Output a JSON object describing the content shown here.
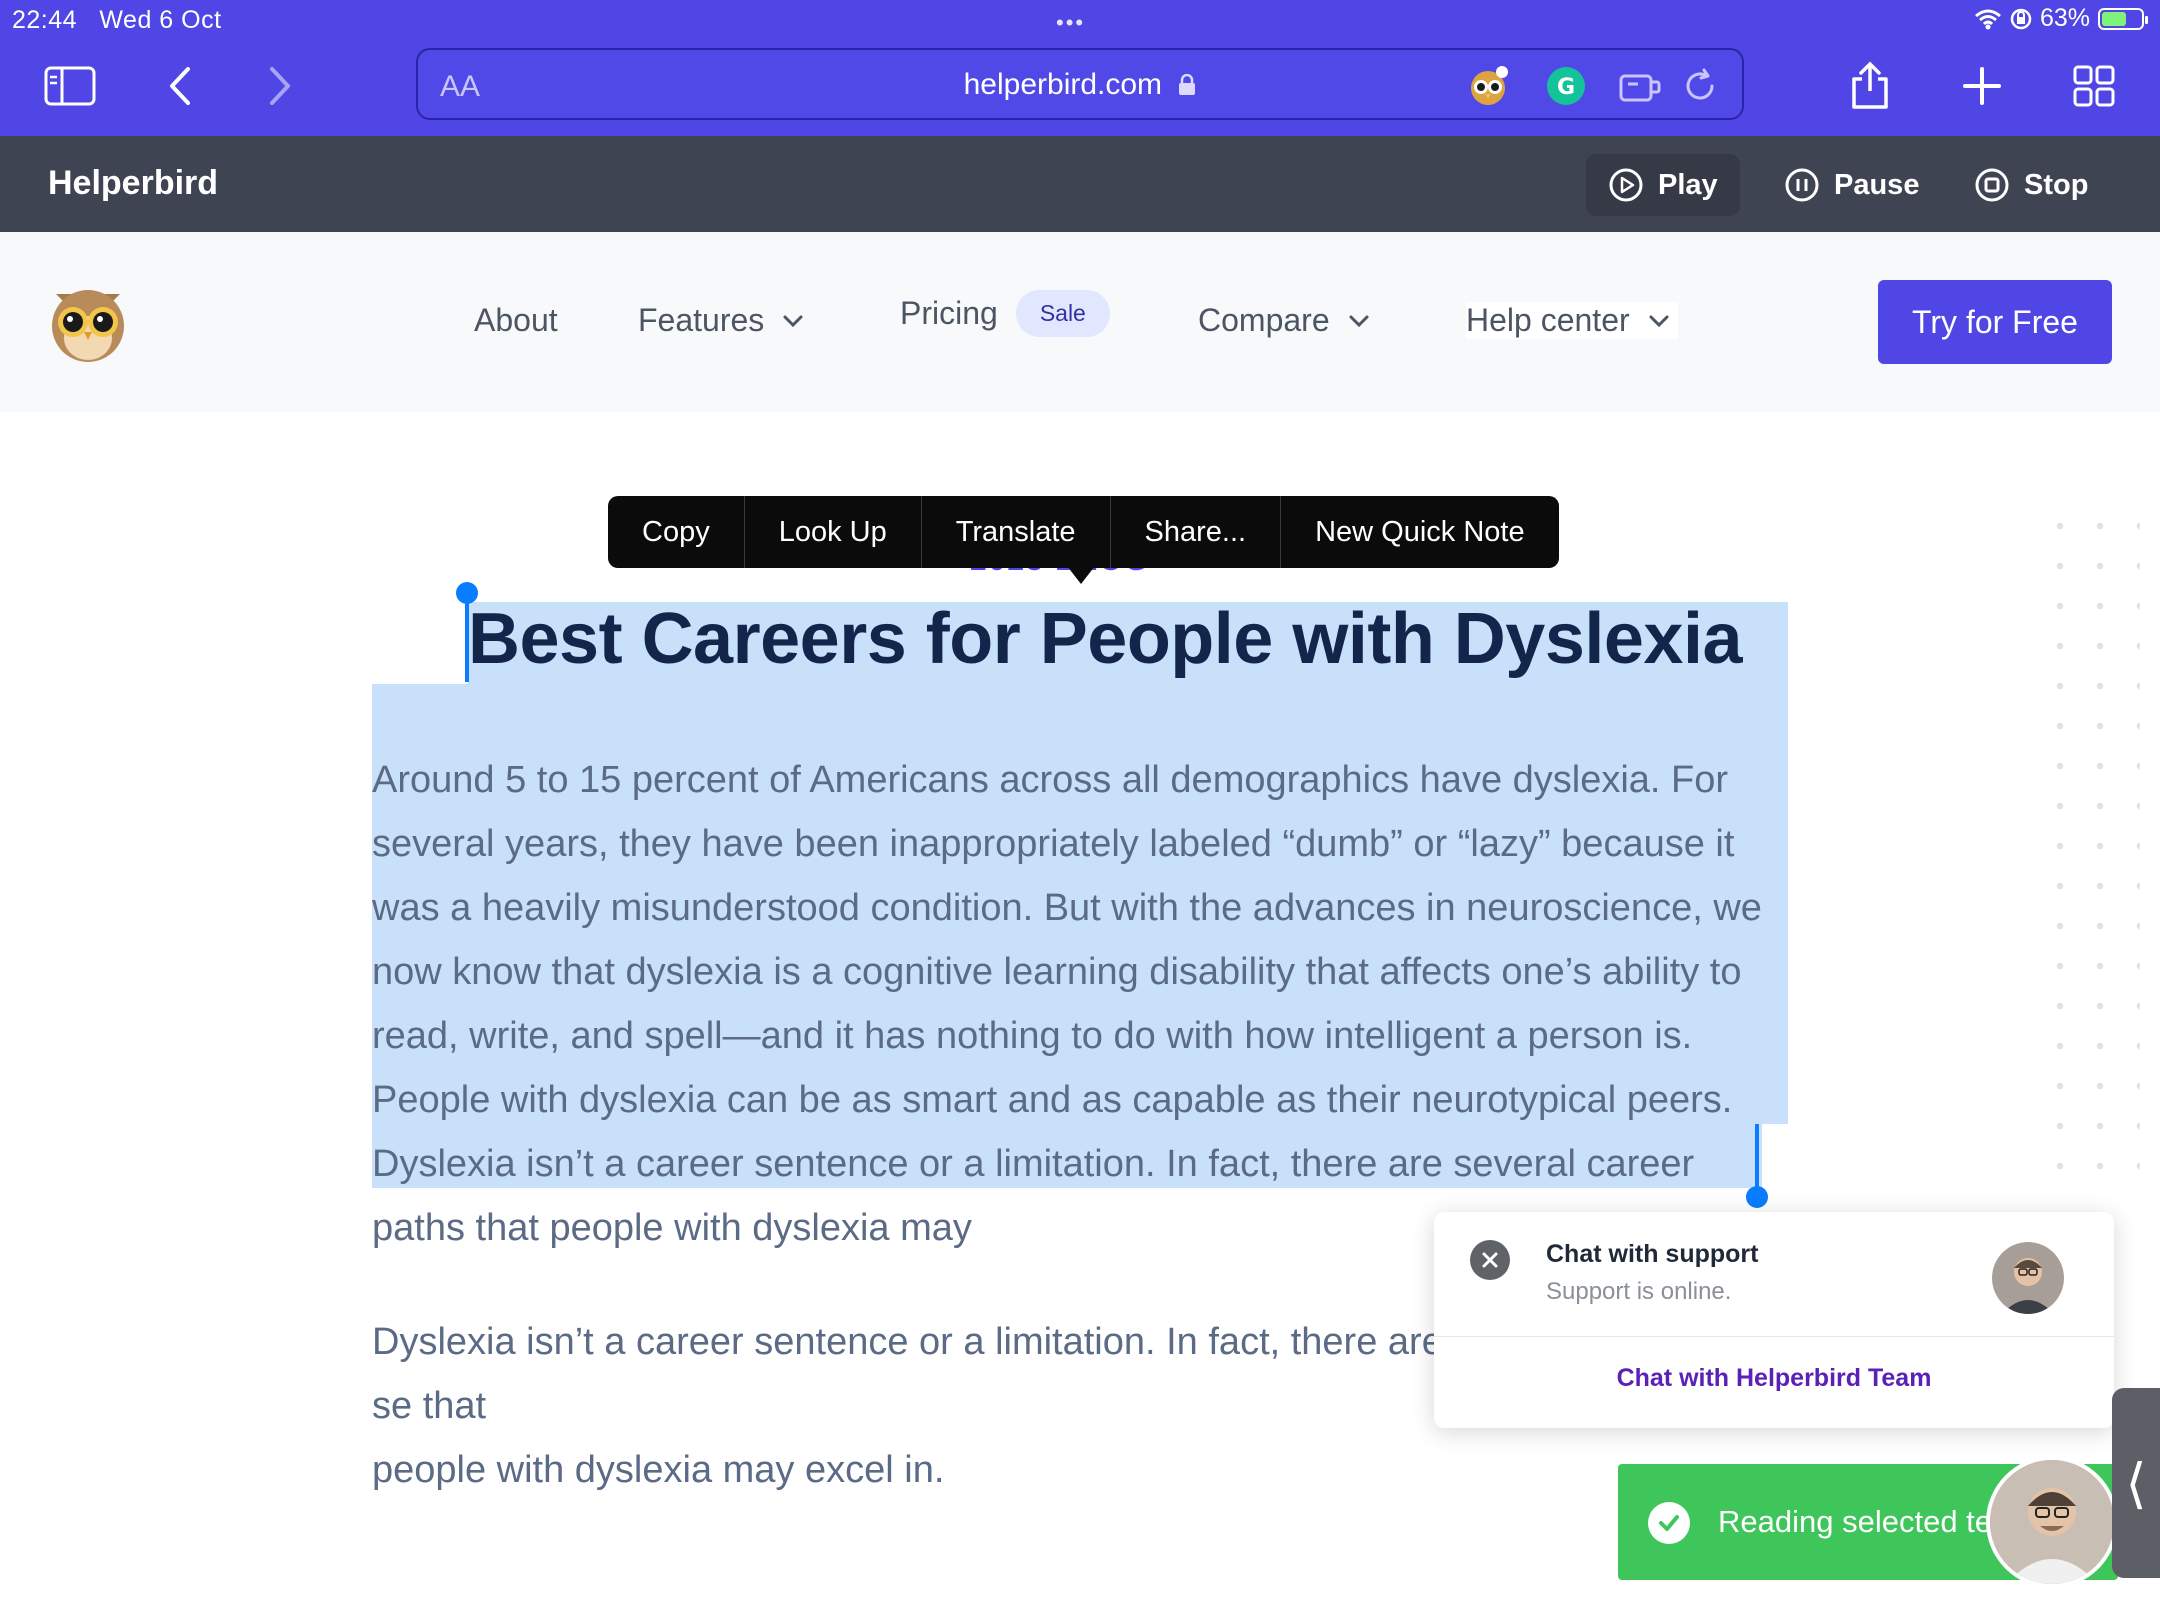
{
  "status_bar": {
    "time": "22:44",
    "date": "Wed 6 Oct",
    "battery": "63%",
    "battery_level": 0.63
  },
  "browser": {
    "text_size_label": "AA",
    "host": "helperbird.com",
    "icons": [
      "sidebar-icon",
      "back-icon",
      "forward-icon",
      "lock-icon",
      "helperbird-extension-icon",
      "grammarly-icon",
      "extension-icon",
      "reload-icon",
      "share-icon",
      "new-tab-icon",
      "tab-overview-icon"
    ]
  },
  "helperbird_bar": {
    "brand": "Helperbird",
    "play": "Play",
    "pause": "Pause",
    "stop": "Stop"
  },
  "nav": {
    "about": "About",
    "features": "Features",
    "pricing": "Pricing",
    "sale_badge": "Sale",
    "compare": "Compare",
    "help_center": "Help center",
    "cta": "Try for Free"
  },
  "context_menu": {
    "items": [
      "Copy",
      "Look Up",
      "Translate",
      "Share...",
      "New Quick Note"
    ]
  },
  "article": {
    "eyebrow": "2023 BLOG",
    "title": "Best Careers for People with Dyslexia",
    "paragraph1": "Around 5 to 15 percent of Americans across all demographics have dyslexia. For several years, they have been inappropriately labeled “dumb” or “lazy” because it was a heavily misunderstood condition. But with the advances in neuroscience, we now know that dyslexia is a cognitive learning disability that affects one’s ability to read, write, and spell—and it has nothing to do with how intelligent a person is. People with dyslexia can be as smart and as capable as their neurotypical peers. Dyslexia isn’t a career sentence or a limitation. In fact, there are several career paths that people with dyslexia may",
    "paragraph2": "Dyslexia isn’t a career sentence or a limitation. In fact, there are se that",
    "paragraph2_line3": "people with dyslexia may excel in."
  },
  "chat": {
    "title": "Chat with support",
    "subtitle": "Support is online.",
    "link": "Chat with Helperbird Team"
  },
  "toast": {
    "text": "Reading selected te"
  },
  "colors": {
    "chrome": "#4f46e5",
    "toolbar": "#3f4453",
    "selection": "#c9e0fb",
    "toast": "#3ec65a",
    "title": "#13254b"
  }
}
